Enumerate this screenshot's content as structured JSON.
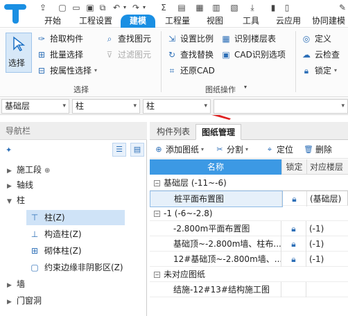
{
  "menu": {
    "items": [
      "开始",
      "工程设置",
      "建模",
      "工程量",
      "视图",
      "工具",
      "云应用",
      "协同建模"
    ],
    "active": "建模"
  },
  "ribbon": {
    "select_label": "选择",
    "pick_component": "拾取构件",
    "batch_select": "批量选择",
    "attr_select": "按属性选择",
    "find_element": "查找图元",
    "filter_element": "过滤图元",
    "select_group": "选择",
    "set_scale": "设置比例",
    "find_replace": "查找替换",
    "restore_cad": "还原CAD",
    "identify_floor_table": "识别楼层表",
    "cad_options": "CAD识别选项",
    "drawing_ops_group": "图纸操作",
    "define": "定义",
    "cloud_check": "云检查",
    "lock": "锁定"
  },
  "selectors": [
    "基础层",
    "柱",
    "柱",
    ""
  ],
  "nav": {
    "title": "导航栏",
    "tree": [
      {
        "label": "施工段",
        "expanded": false
      },
      {
        "label": "轴线",
        "expanded": false
      },
      {
        "label": "柱",
        "expanded": true
      }
    ],
    "children": [
      {
        "label": "柱(Z)",
        "icon": "column-icon",
        "selected": true
      },
      {
        "label": "构造柱(Z)",
        "icon": "structural-column-icon",
        "selected": false
      },
      {
        "label": "砌体柱(Z)",
        "icon": "masonry-column-icon",
        "selected": false
      },
      {
        "label": "约束边缘非阴影区(Z)",
        "icon": "constraint-edge-icon",
        "selected": false
      }
    ],
    "more": [
      {
        "label": "墙"
      },
      {
        "label": "门窗洞"
      }
    ]
  },
  "panel": {
    "tabs": [
      "构件列表",
      "图纸管理"
    ],
    "active_tab": "图纸管理",
    "toolbar": {
      "add": "添加图纸",
      "split": "分割",
      "locate": "定位",
      "delete": "删除"
    },
    "columns": [
      "名称",
      "锁定",
      "对应楼层"
    ],
    "rows": [
      {
        "type": "group",
        "name": "基础层 (-11~-6)"
      },
      {
        "type": "item",
        "name": "桩平面布置图",
        "floor": "(基础层)",
        "selected": true
      },
      {
        "type": "group",
        "name": "-1 (-6~-2.8)"
      },
      {
        "type": "item",
        "name": "-2.800m平面布置图",
        "floor": "(-1)"
      },
      {
        "type": "item",
        "name": "基础顶~-2.800m墙、柱布...",
        "floor": "(-1)"
      },
      {
        "type": "item",
        "name": "12#基础顶~-2.800m墙、...",
        "floor": "(-1)"
      },
      {
        "type": "group",
        "name": "未对应图纸"
      },
      {
        "type": "item",
        "name": "结施-12#13#结构施工图",
        "floor": ""
      }
    ]
  }
}
